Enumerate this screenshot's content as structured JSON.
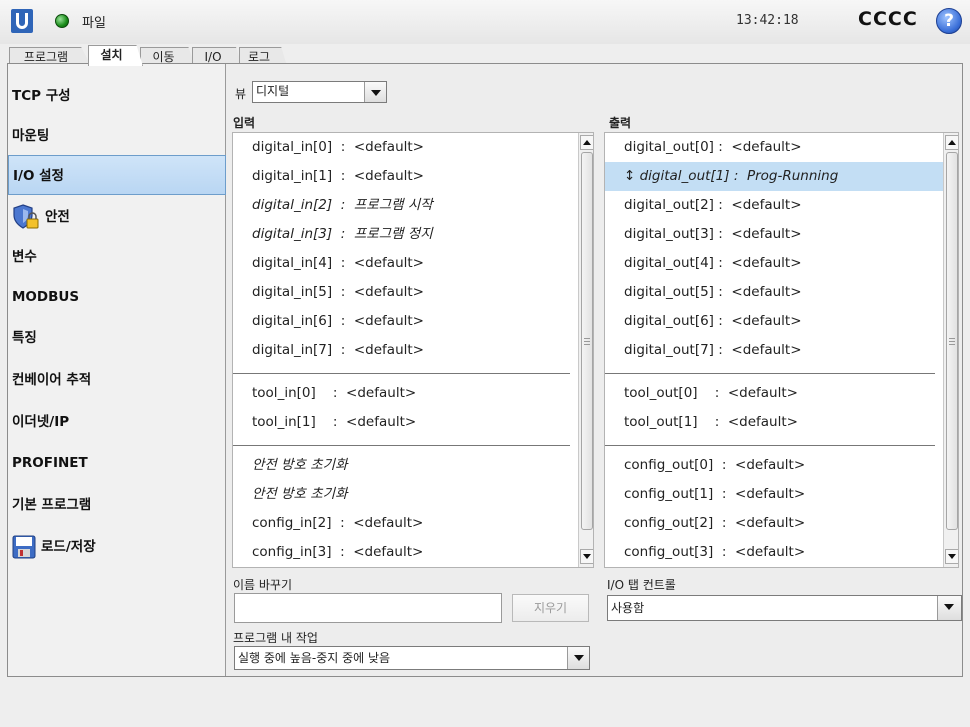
{
  "header": {
    "file_menu": "파일",
    "time": "13:42:18",
    "robot_name": "CCCC",
    "help_symbol": "?",
    "status_color": "#1a8d1a"
  },
  "tabs": [
    {
      "label": "프로그램",
      "active": false
    },
    {
      "label": "설치",
      "active": true
    },
    {
      "label": "이동",
      "active": false
    },
    {
      "label": "I/O",
      "active": false
    },
    {
      "label": "로그",
      "active": false
    }
  ],
  "sidebar": {
    "items": [
      {
        "label": "TCP 구성",
        "active": false
      },
      {
        "label": "마운팅",
        "active": false
      },
      {
        "label": "I/O 설정",
        "active": true
      },
      {
        "label": "안전",
        "active": false,
        "icon": "shield-lock-icon"
      },
      {
        "label": "변수",
        "active": false
      },
      {
        "label": "MODBUS",
        "active": false
      },
      {
        "label": "특징",
        "active": false
      },
      {
        "label": "컨베이어 추적",
        "active": false
      },
      {
        "label": "이더넷/IP",
        "active": false
      },
      {
        "label": "PROFINET",
        "active": false
      },
      {
        "label": "기본 프로그램",
        "active": false
      },
      {
        "label": "로드/저장",
        "active": false,
        "icon": "floppy-disk-icon"
      }
    ]
  },
  "view": {
    "label": "뷰",
    "selected": "디지털"
  },
  "inputs": {
    "title": "입력",
    "groups": [
      [
        {
          "name": "digital_in[0]",
          "sep": "  :  ",
          "value": "<default>",
          "italic": false
        },
        {
          "name": "digital_in[1]",
          "sep": "  :  ",
          "value": "<default>",
          "italic": false
        },
        {
          "name": "digital_in[2]",
          "sep": "  :  ",
          "value": "프로그램 시작",
          "italic": true
        },
        {
          "name": "digital_in[3]",
          "sep": "  :  ",
          "value": "프로그램 정지",
          "italic": true
        },
        {
          "name": "digital_in[4]",
          "sep": "  :  ",
          "value": "<default>",
          "italic": false
        },
        {
          "name": "digital_in[5]",
          "sep": "  :  ",
          "value": "<default>",
          "italic": false
        },
        {
          "name": "digital_in[6]",
          "sep": "  :  ",
          "value": "<default>",
          "italic": false
        },
        {
          "name": "digital_in[7]",
          "sep": "  :  ",
          "value": "<default>",
          "italic": false
        }
      ],
      [
        {
          "name": "tool_in[0]",
          "sep": "    :  ",
          "value": "<default>",
          "italic": false
        },
        {
          "name": "tool_in[1]",
          "sep": "    :  ",
          "value": "<default>",
          "italic": false
        }
      ],
      [
        {
          "name": "안전 방호 초기화",
          "sep": "",
          "value": "",
          "italic": true
        },
        {
          "name": "안전 방호 초기화",
          "sep": "",
          "value": "",
          "italic": true
        },
        {
          "name": "config_in[2]",
          "sep": "  :  ",
          "value": "<default>",
          "italic": false
        },
        {
          "name": "config_in[3]",
          "sep": "  :  ",
          "value": "<default>",
          "italic": false
        }
      ]
    ]
  },
  "outputs": {
    "title": "출력",
    "groups": [
      [
        {
          "name": "digital_out[0]",
          "sep": " :  ",
          "value": "<default>",
          "italic": false,
          "selected": false
        },
        {
          "name": "↕ digital_out[1]",
          "sep": " :  ",
          "value": "Prog-Running",
          "italic": true,
          "selected": true
        },
        {
          "name": "digital_out[2]",
          "sep": " :  ",
          "value": "<default>",
          "italic": false,
          "selected": false
        },
        {
          "name": "digital_out[3]",
          "sep": " :  ",
          "value": "<default>",
          "italic": false,
          "selected": false
        },
        {
          "name": "digital_out[4]",
          "sep": " :  ",
          "value": "<default>",
          "italic": false,
          "selected": false
        },
        {
          "name": "digital_out[5]",
          "sep": " :  ",
          "value": "<default>",
          "italic": false,
          "selected": false
        },
        {
          "name": "digital_out[6]",
          "sep": " :  ",
          "value": "<default>",
          "italic": false,
          "selected": false
        },
        {
          "name": "digital_out[7]",
          "sep": " :  ",
          "value": "<default>",
          "italic": false,
          "selected": false
        }
      ],
      [
        {
          "name": "tool_out[0]",
          "sep": "    :  ",
          "value": "<default>",
          "italic": false,
          "selected": false
        },
        {
          "name": "tool_out[1]",
          "sep": "    :  ",
          "value": "<default>",
          "italic": false,
          "selected": false
        }
      ],
      [
        {
          "name": "config_out[0]",
          "sep": "  :  ",
          "value": "<default>",
          "italic": false,
          "selected": false
        },
        {
          "name": "config_out[1]",
          "sep": "  :  ",
          "value": "<default>",
          "italic": false,
          "selected": false
        },
        {
          "name": "config_out[2]",
          "sep": "  :  ",
          "value": "<default>",
          "italic": false,
          "selected": false
        },
        {
          "name": "config_out[3]",
          "sep": "  :  ",
          "value": "<default>",
          "italic": false,
          "selected": false
        }
      ]
    ]
  },
  "rename": {
    "label": "이름 바꾸기",
    "value": "",
    "clear_label": "지우기"
  },
  "io_tab_control": {
    "label": "I/O 탭 컨트롤",
    "selected": "사용함"
  },
  "in_program_action": {
    "label": "프로그램 내 작업",
    "selected": "실행 중에 높음-중지 중에 낮음"
  },
  "colors": {
    "selection": "#c3def4",
    "active_nav": "#b9d6f3"
  }
}
